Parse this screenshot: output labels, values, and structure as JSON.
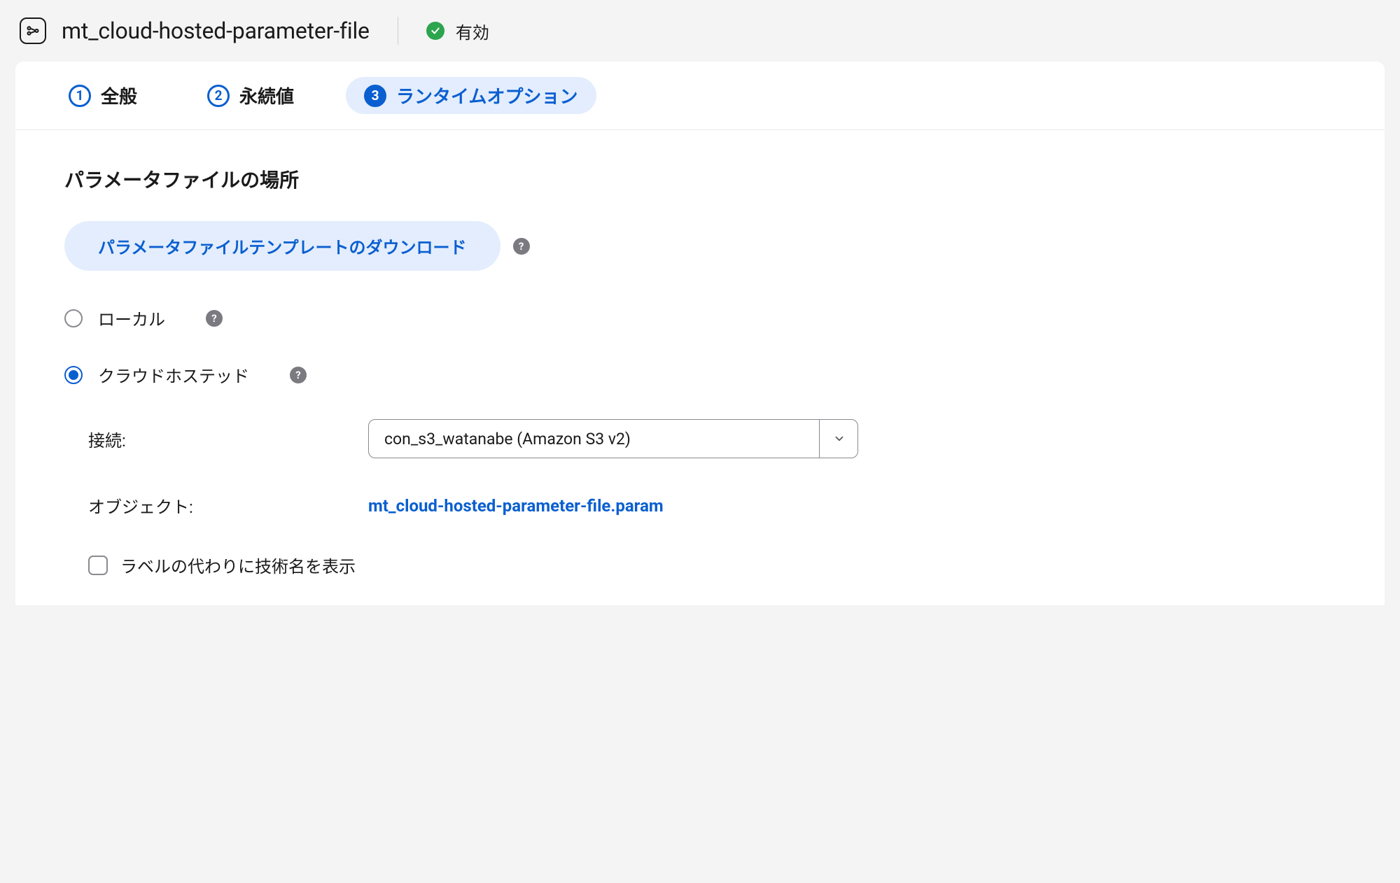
{
  "header": {
    "title": "mt_cloud-hosted-parameter-file",
    "status_label": "有効"
  },
  "tabs": [
    {
      "num": "1",
      "label": "全般"
    },
    {
      "num": "2",
      "label": "永続値"
    },
    {
      "num": "3",
      "label": "ランタイムオプション"
    }
  ],
  "section": {
    "title": "パラメータファイルの場所",
    "download_label": "パラメータファイルテンプレートのダウンロード"
  },
  "radios": {
    "local_label": "ローカル",
    "cloud_label": "クラウドホステッド"
  },
  "form": {
    "connection_label": "接続:",
    "connection_value": "con_s3_watanabe (Amazon S3 v2)",
    "object_label": "オブジェクト:",
    "object_value": "mt_cloud-hosted-parameter-file.param",
    "tech_names_label": "ラベルの代わりに技術名を表示"
  }
}
